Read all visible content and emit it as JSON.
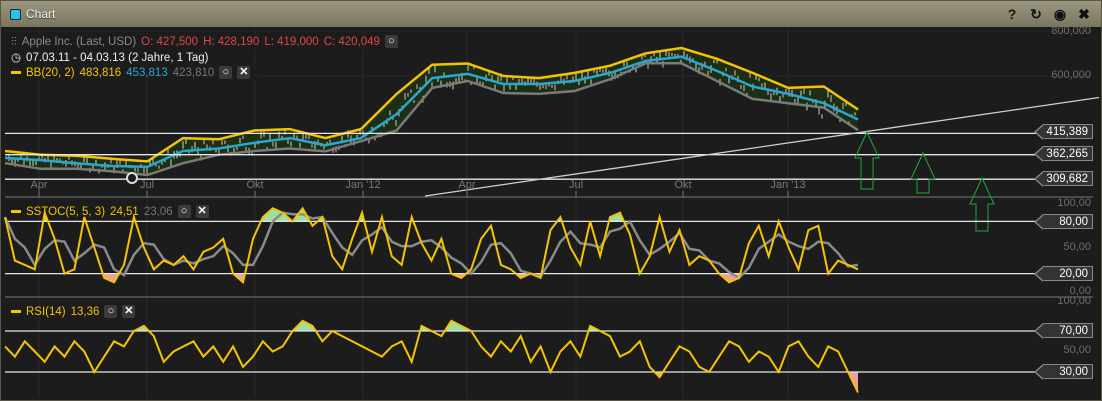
{
  "window": {
    "title": "Chart",
    "buttons": {
      "help": "?",
      "reset": "↻",
      "record": "◉",
      "close": "✖"
    }
  },
  "header": {
    "instrument": "Apple Inc. (Last, USD)",
    "open": "O: 427,500",
    "high": "H: 428,190",
    "low": "L: 419,000",
    "close": "C: 420,049",
    "range": "07.03.11 - 04.03.13 (2 Jahre, 1 Tag)"
  },
  "indicators": {
    "bb": {
      "label": "BB(20, 2)",
      "upper": "483,816",
      "middle": "453,813",
      "lower": "423,810"
    },
    "sstoc": {
      "label": "SSTOC(5, 5, 3)",
      "k": "24,51",
      "d": "23,06"
    },
    "rsi": {
      "label": "RSI(14)",
      "value": "13,36"
    }
  },
  "colors": {
    "upper": "#f5c400",
    "middle": "#2aa6d0",
    "lower": "#7a7a7a",
    "band_fill": "#1d2e17",
    "overbought": "#9de0a0",
    "oversold": "#e8a0a0",
    "arrows": "#1fa83a"
  },
  "chart_data": [
    {
      "type": "line",
      "scale": "log",
      "series": [
        {
          "values": [
            371,
            362,
            360,
            353,
            347,
            403,
            400,
            423,
            427,
            403,
            427,
            535,
            645,
            650,
            600,
            592,
            612,
            641,
            694,
            718,
            670,
            612,
            556,
            561,
            484
          ]
        },
        {
          "values": [
            355,
            350,
            343,
            337,
            335,
            371,
            377,
            391,
            403,
            385,
            403,
            470,
            592,
            608,
            570,
            570,
            581,
            612,
            661,
            679,
            620,
            561,
            535,
            504,
            454
          ]
        },
        {
          "values": [
            343,
            331,
            331,
            326,
            318,
            343,
            362,
            371,
            377,
            370,
            395,
            423,
            556,
            581,
            538,
            535,
            545,
            588,
            651,
            651,
            581,
            518,
            504,
            490,
            424
          ]
        }
      ],
      "x_ticks": [
        "Apr",
        "Jul",
        "Okt",
        "Jan '12",
        "Apr",
        "Jul",
        "Okt",
        "Jan '13"
      ],
      "y_ticks": [
        "800,000",
        "600,000"
      ],
      "levels": [
        "415,389",
        "362,265",
        "309,682"
      ],
      "grid": true
    },
    {
      "type": "line",
      "ylim": [
        0,
        100
      ],
      "y_ticks": [
        "100,00",
        "50,00",
        "0,00"
      ],
      "levels": [
        "80,00",
        "20,00"
      ],
      "values": [
        85,
        35,
        30,
        25,
        90,
        60,
        20,
        25,
        85,
        50,
        15,
        10,
        30,
        85,
        50,
        25,
        35,
        30,
        40,
        25,
        45,
        50,
        60,
        20,
        10,
        60,
        85,
        95,
        90,
        80,
        95,
        75,
        85,
        40,
        25,
        60,
        90,
        45,
        85,
        40,
        30,
        85,
        55,
        35,
        60,
        20,
        15,
        25,
        60,
        75,
        30,
        25,
        15,
        20,
        15,
        70,
        85,
        50,
        30,
        80,
        40,
        85,
        90,
        65,
        20,
        40,
        85,
        45,
        70,
        30,
        40,
        35,
        20,
        10,
        15,
        55,
        75,
        40,
        80,
        50,
        25,
        70,
        75,
        20,
        35,
        30,
        25
      ]
    },
    {
      "type": "line",
      "ylim": [
        0,
        100
      ],
      "y_ticks": [
        "100,00",
        "50,00"
      ],
      "levels": [
        "70,00",
        "30,00"
      ],
      "values": [
        55,
        45,
        60,
        50,
        40,
        55,
        45,
        60,
        50,
        30,
        45,
        60,
        55,
        70,
        75,
        65,
        40,
        50,
        55,
        60,
        45,
        55,
        40,
        55,
        35,
        45,
        60,
        50,
        55,
        70,
        80,
        75,
        60,
        70,
        65,
        60,
        55,
        50,
        45,
        55,
        60,
        40,
        75,
        70,
        65,
        80,
        75,
        70,
        55,
        45,
        60,
        50,
        65,
        40,
        55,
        30,
        50,
        60,
        45,
        75,
        70,
        65,
        45,
        50,
        60,
        35,
        25,
        40,
        55,
        50,
        35,
        30,
        45,
        60,
        55,
        40,
        50,
        45,
        30,
        55,
        60,
        45,
        35,
        55,
        50,
        30,
        10
      ]
    }
  ]
}
